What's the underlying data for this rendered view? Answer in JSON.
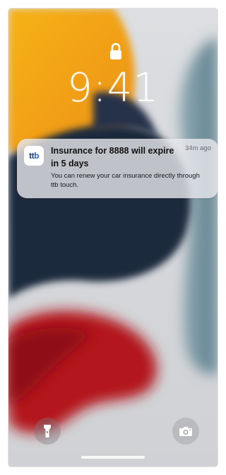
{
  "lock_screen": {
    "time": "9:41"
  },
  "notification": {
    "app_icon_text": {
      "part1": "t",
      "part2": "t",
      "part3": "b"
    },
    "title": "Insurance for 8888 will expire in 5 days",
    "time_ago": "34m ago",
    "body": "You can renew your car insurance directly through ttb touch."
  },
  "controls": {
    "left_button_icon": "flashlight-icon",
    "right_button_icon": "camera-icon"
  },
  "colors": {
    "wallpaper_orange": "#f2a313",
    "wallpaper_navy": "#1f2a3d",
    "wallpaper_red": "#b3181d",
    "wallpaper_teal": "#6d8f9c",
    "wallpaper_background": "#d7d9dc"
  }
}
